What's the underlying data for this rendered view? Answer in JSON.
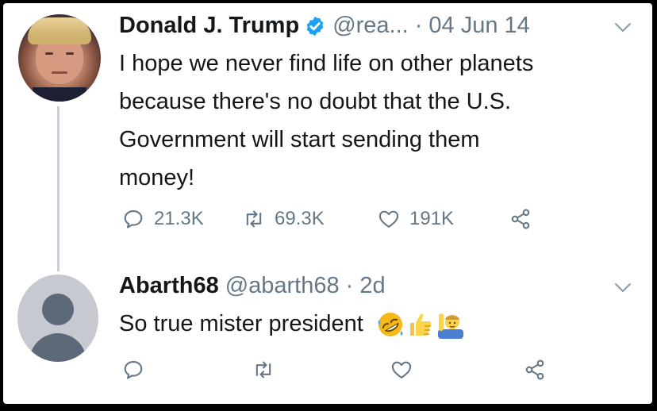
{
  "tweet": {
    "author_name": "Donald J. Trump",
    "handle": "@rea...",
    "separator": "·",
    "time": "04 Jun 14",
    "text": "I hope we never find life on other planets\nbecause there's no doubt that the U.S.\nGovernment will start sending them\nmoney!",
    "replies": "21.3K",
    "retweets": "69.3K",
    "likes": "191K",
    "icons": {
      "verified": "verified-badge-icon",
      "reply": "reply-icon",
      "retweet": "retweet-icon",
      "like": "heart-icon",
      "share": "share-icon",
      "menu": "chevron-down-icon"
    }
  },
  "reply": {
    "author_name": "Abarth68",
    "handle": "@abarth68",
    "separator": "·",
    "time": "2d",
    "text": "So true mister president",
    "emojis": [
      "rolling-on-floor-laughing-emoji",
      "thumbs-up-emoji",
      "man-raising-hand-emoji"
    ]
  },
  "colors": {
    "text": "#14171a",
    "secondary": "#657786",
    "verified": "#1da1f2",
    "thread_line": "#c7d0d8"
  }
}
